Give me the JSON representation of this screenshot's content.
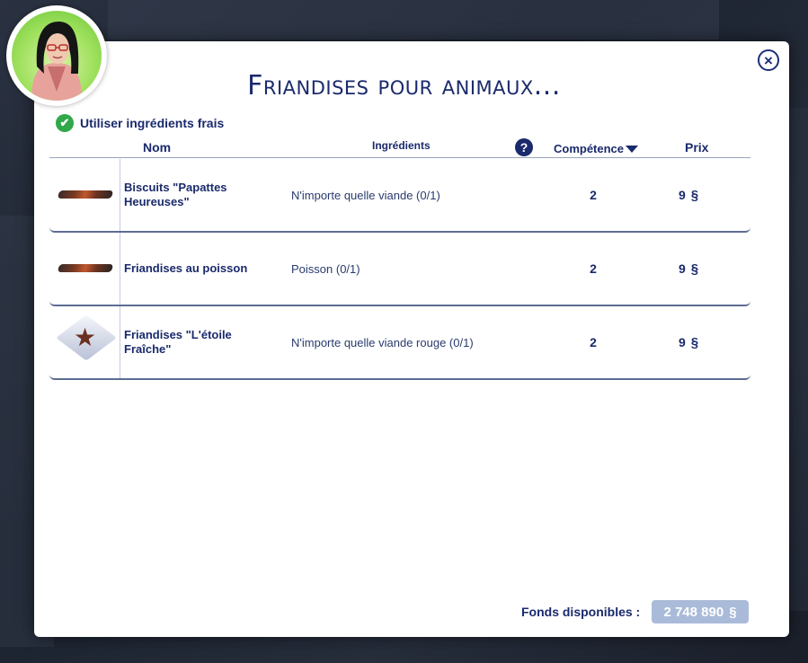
{
  "dialog": {
    "title": "Friandises pour animaux...",
    "close_label": "×",
    "fresh_ingredients_label": "Utiliser ingrédients frais",
    "fresh_ingredients_checked": true
  },
  "columns": {
    "name": "Nom",
    "ingredients": "Ingrédients",
    "help": "?",
    "skill": "Compétence",
    "price": "Prix"
  },
  "recipes": [
    {
      "name": "Biscuits \"Papattes Heureuses\"",
      "ingredients": "N'importe quelle viande (0/1)",
      "skill": "2",
      "price": "9",
      "icon": "meat-treat-icon"
    },
    {
      "name": "Friandises au poisson",
      "ingredients": "Poisson (0/1)",
      "skill": "2",
      "price": "9",
      "icon": "fish-treat-icon"
    },
    {
      "name": "Friandises \"L'étoile Fraîche\"",
      "ingredients": "N'importe quelle viande rouge (0/1)",
      "skill": "2",
      "price": "9",
      "icon": "star-treat-icon"
    }
  ],
  "currency_symbol": "§",
  "funds": {
    "label": "Fonds disponibles :",
    "amount": "2 748 890"
  },
  "colors": {
    "accent": "#1a2a6c",
    "check": "#31a84a",
    "funds_box": "#a9bbd8"
  }
}
